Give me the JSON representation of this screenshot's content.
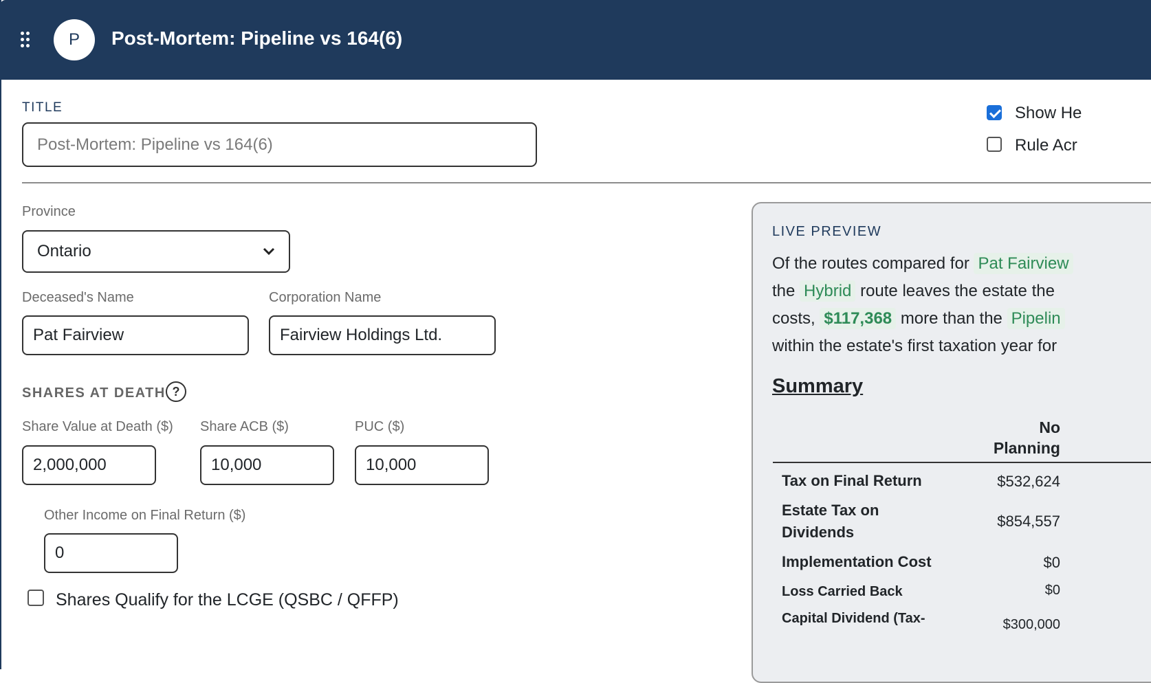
{
  "header": {
    "avatar_letter": "P",
    "title": "Post-Mortem: Pipeline vs 164(6)"
  },
  "title_section": {
    "label": "TITLE",
    "placeholder": "Post-Mortem: Pipeline vs 164(6)",
    "value": ""
  },
  "options": {
    "show_header": {
      "label": "Show He",
      "checked": true
    },
    "rule_across": {
      "label": "Rule Acr",
      "checked": false
    }
  },
  "province": {
    "label": "Province",
    "value": "Ontario"
  },
  "deceased_name": {
    "label": "Deceased's Name",
    "value": "Pat Fairview"
  },
  "corporation_name": {
    "label": "Corporation Name",
    "value": "Fairview Holdings Ltd."
  },
  "shares": {
    "heading": "SHARES AT DEATH",
    "help": "?",
    "share_value": {
      "label": "Share Value at Death ($)",
      "value": "2,000,000"
    },
    "share_acb": {
      "label": "Share ACB ($)",
      "value": "10,000"
    },
    "puc": {
      "label": "PUC ($)",
      "value": "10,000"
    },
    "other_income": {
      "label": "Other Income on Final Return ($)",
      "value": "0"
    },
    "lcge": {
      "label": "Shares Qualify for the LCGE (QSBC / QFFP)",
      "checked": false
    }
  },
  "preview": {
    "label": "LIVE PREVIEW",
    "line1_a": "Of the routes compared for",
    "line1_name": "Pat Fairview",
    "line2_a": "the",
    "line2_route": "Hybrid",
    "line2_b": "route leaves the estate the",
    "line3_a": "costs,",
    "line3_amount": "$117,368",
    "line3_b": "more than the",
    "line3_route": "Pipelin",
    "line4": "within the estate's first taxation year for",
    "summary_title": "Summary",
    "column_header_line1": "No",
    "column_header_line2": "Planning",
    "rows": [
      {
        "label_line1": "Tax on Final Return",
        "label_line2": "",
        "value": "$532,624"
      },
      {
        "label_line1": "Estate Tax on",
        "label_line2": "Dividends",
        "value": "$854,557"
      },
      {
        "label_line1": "Implementation Cost",
        "label_line2": "",
        "value": "$0"
      },
      {
        "label_line1": "Loss Carried Back",
        "label_line2": "",
        "value": "$0"
      },
      {
        "label_line1": "Capital Dividend (Tax-",
        "label_line2": "",
        "value": "$300,000"
      }
    ]
  },
  "colors": {
    "header_bg": "#1f3a5c",
    "highlight_text": "#2e8b57",
    "highlight_bg": "#e6f1e9",
    "checkbox_checked": "#1a6fd9",
    "preview_bg": "#eceef1"
  }
}
